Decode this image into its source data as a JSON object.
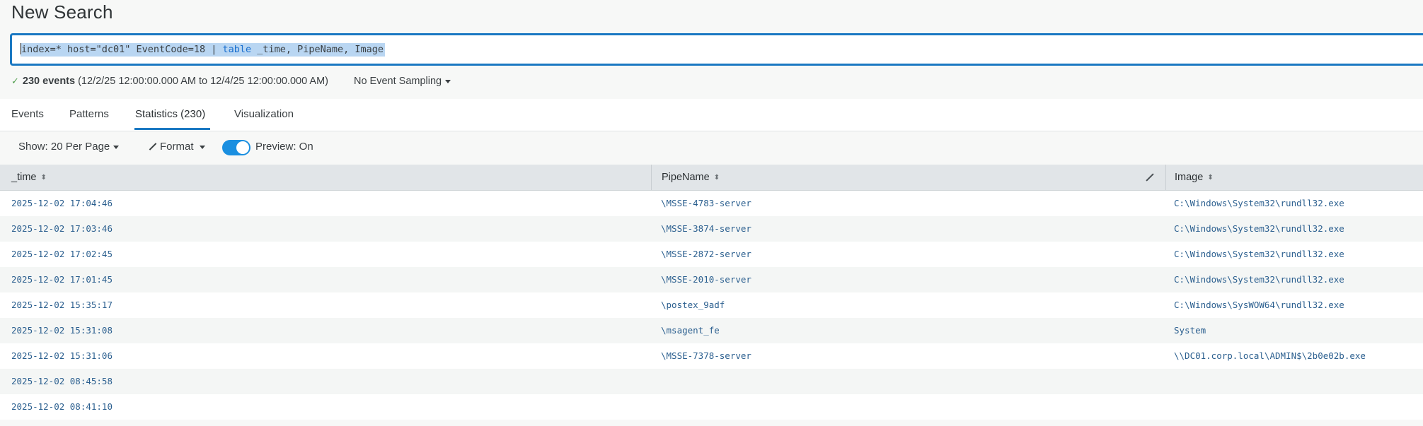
{
  "page": {
    "title": "New Search"
  },
  "search": {
    "query_prefix": "index=* host=\"dc01\" EventCode=18 | ",
    "query_command": "table",
    "query_suffix": " _time, PipeName, Image"
  },
  "status": {
    "check_icon": "check-icon",
    "event_count": "230 events",
    "time_range": "(12/2/25 12:00:00.000 AM to 12/4/25 12:00:00.000 AM)",
    "sampling": "No Event Sampling"
  },
  "tabs": [
    {
      "label": "Events",
      "active": false
    },
    {
      "label": "Patterns",
      "active": false
    },
    {
      "label": "Statistics (230)",
      "active": true
    },
    {
      "label": "Visualization",
      "active": false
    }
  ],
  "toolbar": {
    "show": "Show: 20 Per Page",
    "format": "Format",
    "preview": "Preview: On",
    "preview_on": true
  },
  "colors": {
    "accent": "#1a78c2",
    "toggle": "#1a8fe0",
    "success": "#53a051",
    "link_text": "#2b5f8f"
  },
  "table": {
    "columns": [
      "_time",
      "PipeName",
      "Image"
    ],
    "rows": [
      [
        "2025-12-02 17:04:46",
        "\\MSSE-4783-server",
        "C:\\Windows\\System32\\rundll32.exe"
      ],
      [
        "2025-12-02 17:03:46",
        "\\MSSE-3874-server",
        "C:\\Windows\\System32\\rundll32.exe"
      ],
      [
        "2025-12-02 17:02:45",
        "\\MSSE-2872-server",
        "C:\\Windows\\System32\\rundll32.exe"
      ],
      [
        "2025-12-02 17:01:45",
        "\\MSSE-2010-server",
        "C:\\Windows\\System32\\rundll32.exe"
      ],
      [
        "2025-12-02 15:35:17",
        "\\postex_9adf",
        "C:\\Windows\\SysWOW64\\rundll32.exe"
      ],
      [
        "2025-12-02 15:31:08",
        "\\msagent_fe",
        "System"
      ],
      [
        "2025-12-02 15:31:06",
        "\\MSSE-7378-server",
        "\\\\DC01.corp.local\\ADMIN$\\2b0e02b.exe"
      ],
      [
        "2025-12-02 08:45:58",
        "",
        ""
      ],
      [
        "2025-12-02 08:41:10",
        "",
        ""
      ]
    ]
  }
}
